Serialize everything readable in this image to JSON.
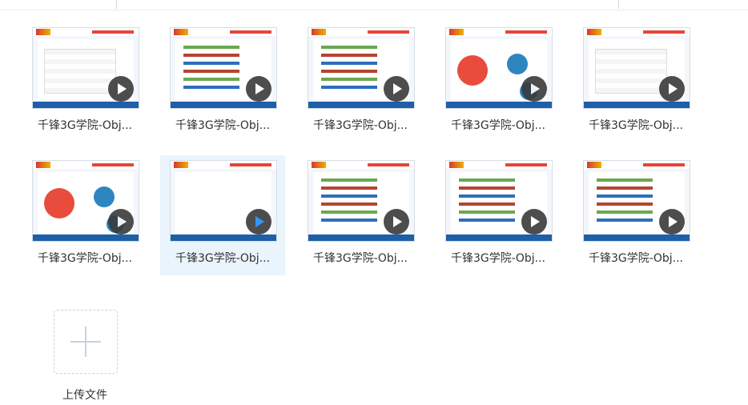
{
  "items": [
    {
      "title": "千锋3G学院-Obj..."
    },
    {
      "title": "千锋3G学院-Obj..."
    },
    {
      "title": "千锋3G学院-Obj..."
    },
    {
      "title": "千锋3G学院-Obj..."
    },
    {
      "title": "千锋3G学院-Obj..."
    },
    {
      "title": "千锋3G学院-Obj..."
    },
    {
      "title": "千锋3G学院-Obj..."
    },
    {
      "title": "千锋3G学院-Obj..."
    },
    {
      "title": "千锋3G学院-Obj..."
    },
    {
      "title": "千锋3G学院-Obj..."
    }
  ],
  "upload": {
    "label": "上传文件"
  },
  "colors": {
    "selected_bg": "#eaf4fd",
    "play": "#3a3a3a",
    "play_active": "#1a8cff"
  }
}
